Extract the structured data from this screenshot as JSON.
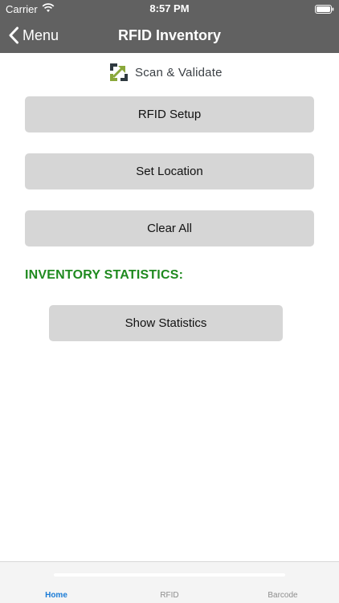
{
  "status_bar": {
    "carrier": "Carrier",
    "time": "8:57 PM",
    "icons": [
      "wifi-icon",
      "battery-icon"
    ]
  },
  "nav": {
    "back_label": "Menu",
    "title": "RFID Inventory",
    "back_icon": "chevron-left-icon"
  },
  "logo": {
    "text": "Scan & Validate",
    "colors": {
      "dark": "#2f3a40",
      "accent": "#8aa83a"
    }
  },
  "buttons": {
    "rfid_setup": "RFID Setup",
    "set_location": "Set Location",
    "clear_all": "Clear All",
    "show_statistics": "Show Statistics"
  },
  "section": {
    "heading": "INVENTORY STATISTICS:",
    "heading_color": "#1f8a1f"
  },
  "tabs": [
    {
      "label": "Home",
      "active": true
    },
    {
      "label": "RFID",
      "active": false
    },
    {
      "label": "Barcode",
      "active": false
    }
  ],
  "colors": {
    "nav_background": "#616161",
    "button_background": "#d6d6d6",
    "tab_active": "#1a7bd6",
    "tab_inactive": "#8e8e8e"
  }
}
